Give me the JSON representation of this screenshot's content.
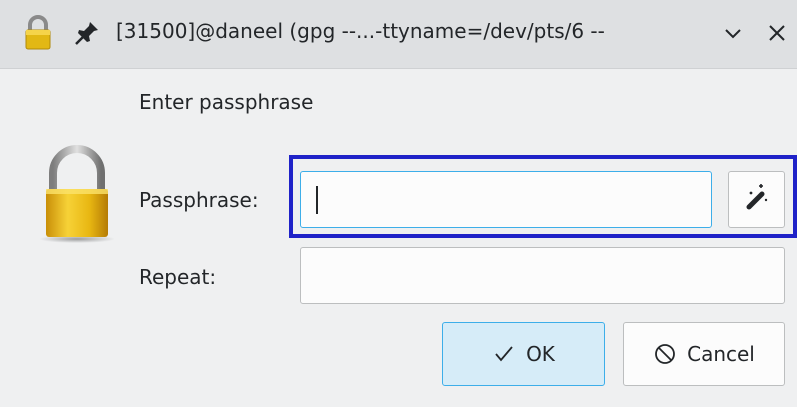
{
  "window": {
    "title": "[31500]@daneel (gpg --...-ttyname=/dev/pts/6 --",
    "icons": [
      "lock-icon",
      "pin-icon",
      "minimize-chevron-icon",
      "close-icon"
    ]
  },
  "dialog": {
    "heading": "Enter passphrase",
    "passphrase_label": "Passphrase:",
    "passphrase_value": "",
    "repeat_label": "Repeat:",
    "repeat_value": "",
    "generate_button_icon": "magic-wand-icon",
    "ok_label": "OK",
    "cancel_label": "Cancel"
  },
  "colors": {
    "accent": "#3daee9",
    "focus_highlight": "#1f22c8",
    "ok_button_bg": "#d6ecf8"
  }
}
